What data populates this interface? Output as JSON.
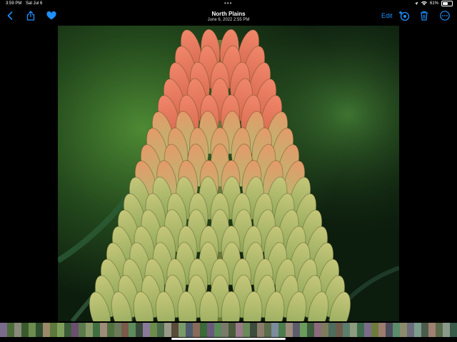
{
  "status": {
    "time": "3:59 PM",
    "date": "Sat Jul 6",
    "battery_text": "61%",
    "battery_level": 0.61
  },
  "toolbar": {
    "title": "North Plains",
    "subtitle": "June 6, 2022  2:55 PM",
    "edit_label": "Edit"
  },
  "icons": {
    "back": "chevron-left-icon",
    "share": "share-icon",
    "favorite": "heart-icon",
    "adjust": "live-adjust-icon",
    "delete": "trash-icon",
    "more": "ellipsis-circle-icon"
  },
  "colors": {
    "accent": "#1e90ff",
    "background": "#000000"
  },
  "filmstrip": {
    "thumb_colors": [
      "#7a6a8c",
      "#4b6b3a",
      "#8a8a7a",
      "#3a5a2e",
      "#6d8c4f",
      "#2f4f2f",
      "#9a8a6a",
      "#5c7a3c",
      "#7fa05a",
      "#3d5c3a",
      "#6b4f6f",
      "#5a7a4a",
      "#8c9a6a",
      "#3f6f3f",
      "#a08c7a",
      "#4f6f3f",
      "#6a7a5a",
      "#7a5a4a",
      "#5c8c5c",
      "#3a4a3a",
      "#8a7a9a",
      "#6c8c4c",
      "#4a6a4a",
      "#9a9a8a",
      "#5a4a3a",
      "#7a9a6a",
      "#4c5c6c",
      "#8a6a5a",
      "#3a6a3a",
      "#6a5a7a",
      "#5a8a5a",
      "#7a7a6a",
      "#4a5a3a",
      "#9a7a8a",
      "#6a8a5a",
      "#3c4c3c",
      "#8c7c6c",
      "#5c6c4c",
      "#7c8c9c",
      "#4c7c4c",
      "#9c8c7c",
      "#5c5c6c",
      "#6c9c5c",
      "#3c5c3c",
      "#8c6c7c",
      "#7c7c5c",
      "#4c6c5c",
      "#6c5c4c",
      "#5c7c6c",
      "#8c9c7c",
      "#3c6c4c",
      "#7c6c8c",
      "#6c7c3c",
      "#9c7c6c",
      "#4c4c5c",
      "#5c8c6c",
      "#8c8c6c",
      "#6c6c7c",
      "#7c9c8c",
      "#4c5c4c",
      "#a08070",
      "#5a6a4a",
      "#8a9a8a",
      "#3a5a4a"
    ]
  }
}
